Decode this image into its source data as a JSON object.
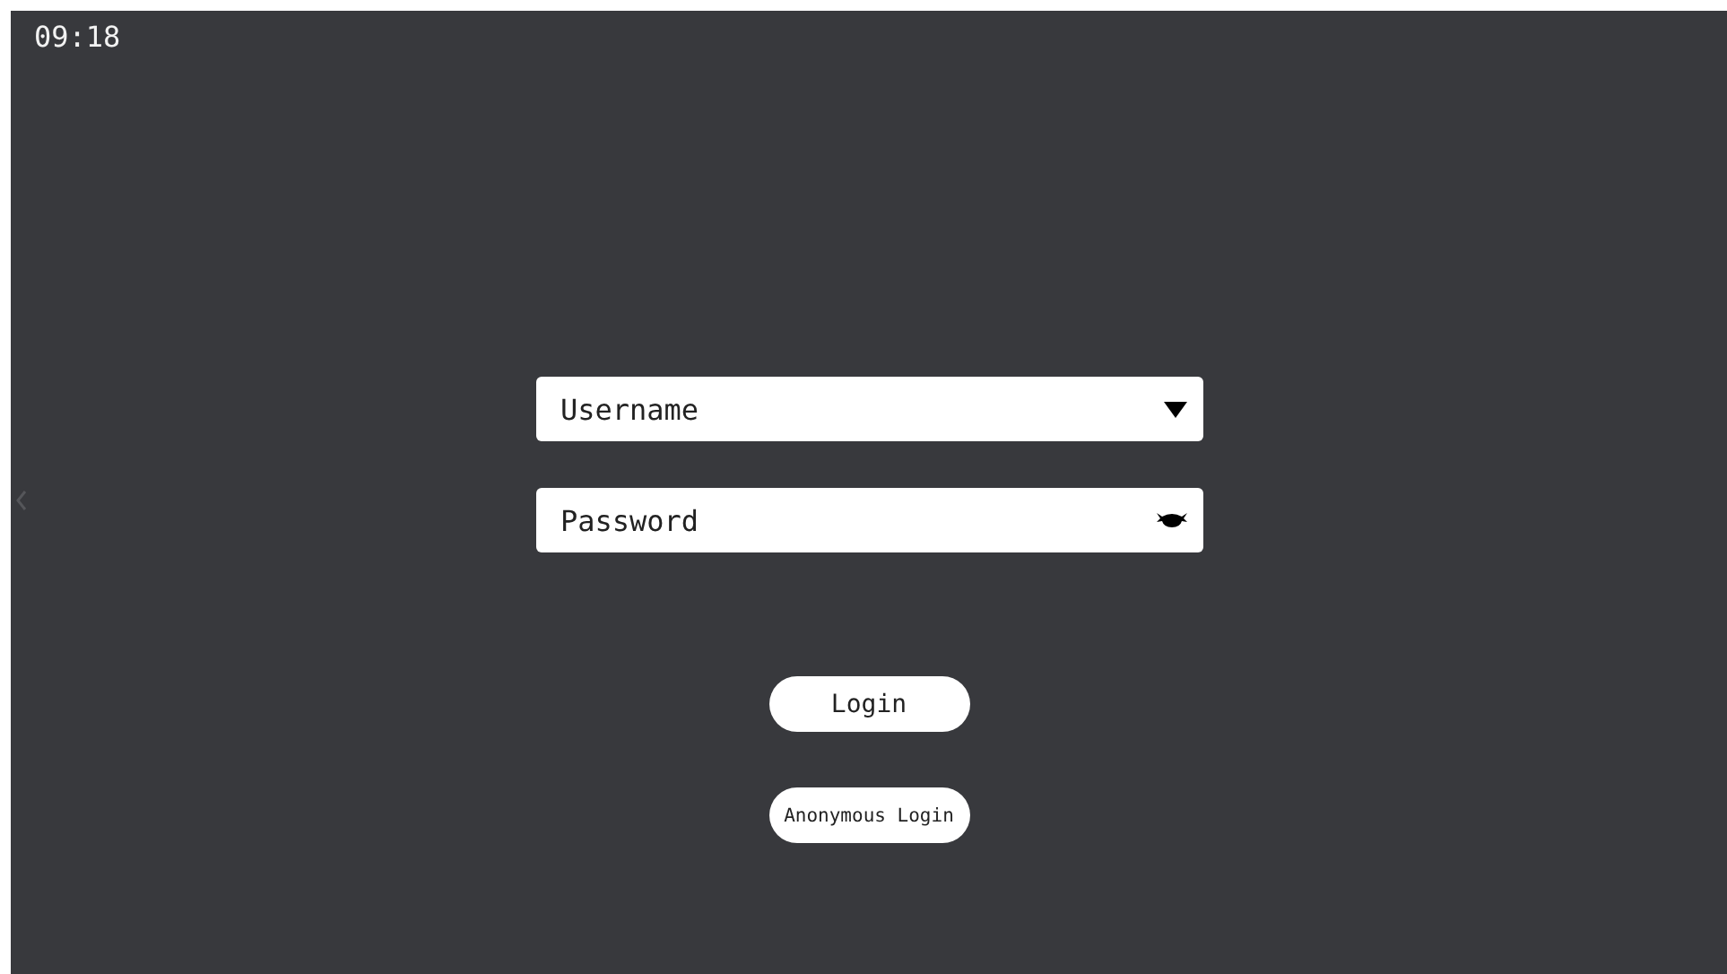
{
  "status_bar": {
    "time": "09:18"
  },
  "username": {
    "placeholder": "Username"
  },
  "password": {
    "placeholder": "Password"
  },
  "buttons": [
    {
      "kind": "primary",
      "label": "Login"
    },
    {
      "kind": "secondary",
      "label": "Anonymous Login"
    }
  ]
}
